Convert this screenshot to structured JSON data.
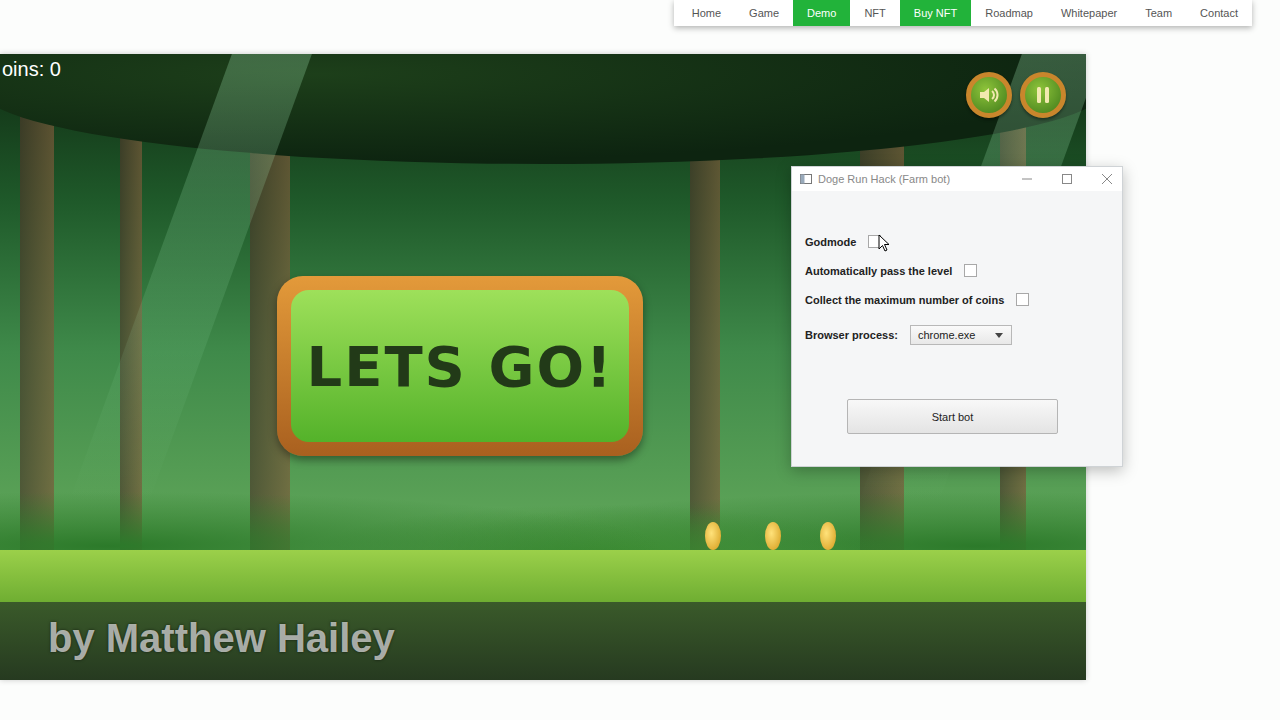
{
  "nav": {
    "items": [
      {
        "label": "Home",
        "highlighted": false
      },
      {
        "label": "Game",
        "highlighted": false
      },
      {
        "label": "Demo",
        "highlighted": true
      },
      {
        "label": "NFT",
        "highlighted": false
      },
      {
        "label": "Buy NFT",
        "highlighted": true
      },
      {
        "label": "Roadmap",
        "highlighted": false
      },
      {
        "label": "Whitepaper",
        "highlighted": false
      },
      {
        "label": "Team",
        "highlighted": false
      },
      {
        "label": "Contact",
        "highlighted": false
      }
    ]
  },
  "game": {
    "coins_label": "oins: 0",
    "sign": "LETS GO!",
    "watermark": "by Matthew Hailey"
  },
  "window": {
    "title": "Doge Run Hack (Farm bot)",
    "options": [
      {
        "label": "Godmode",
        "checked": false
      },
      {
        "label": "Automatically pass the level",
        "checked": false
      },
      {
        "label": "Collect the maximum number of coins",
        "checked": false
      }
    ],
    "browser_process": {
      "label": "Browser process:",
      "value": "chrome.exe"
    },
    "start_button": "Start bot"
  }
}
